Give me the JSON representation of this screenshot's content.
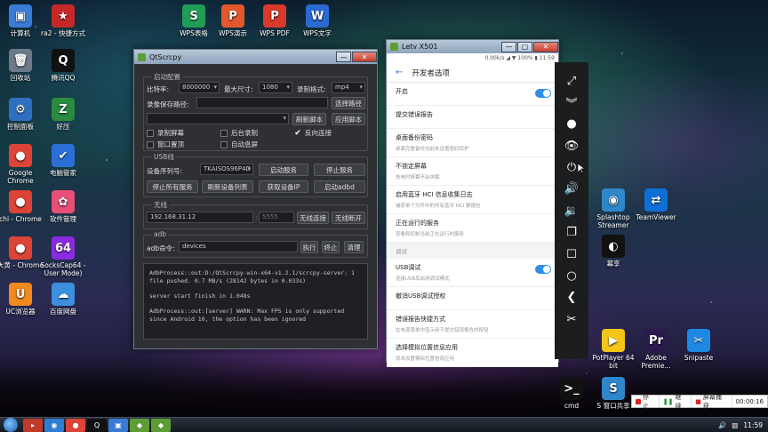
{
  "desktop_icons_left": [
    {
      "label": "计算机",
      "glyph": "▣",
      "color": "#3a7bd5"
    },
    {
      "label": "回收站",
      "glyph": "🗑",
      "color": "#6c7a89"
    },
    {
      "label": "控制面板",
      "glyph": "⚙",
      "color": "#2f6fc0"
    },
    {
      "label": "Google Chrome",
      "glyph": "●",
      "color": "#db4437"
    },
    {
      "label": "chi - Chrome",
      "glyph": "●",
      "color": "#db4437"
    },
    {
      "label": "大黄 - Chrome",
      "glyph": "●",
      "color": "#db4437"
    },
    {
      "label": "UC浏览器",
      "glyph": "U",
      "color": "#f28a1e"
    }
  ],
  "desktop_icons_col2": [
    {
      "label": "ra2 - 快捷方式",
      "glyph": "★",
      "color": "#c62828"
    },
    {
      "label": "腾讯QQ",
      "glyph": "Q",
      "color": "#111111"
    },
    {
      "label": "好压",
      "glyph": "Z",
      "color": "#2a8a3f"
    },
    {
      "label": "电脑管家",
      "glyph": "✔",
      "color": "#2b6fd6"
    },
    {
      "label": "软件管理",
      "glyph": "✿",
      "color": "#e94e77"
    },
    {
      "label": "SocksCap64 - User Mode)",
      "glyph": "64",
      "color": "#8a2be2"
    },
    {
      "label": "百度网盘",
      "glyph": "☁",
      "color": "#3d8fe0"
    }
  ],
  "desktop_icons_top": [
    {
      "label": "WPS表格",
      "glyph": "S",
      "color": "#1f9d55"
    },
    {
      "label": "WPS演示",
      "glyph": "P",
      "color": "#e3572d"
    },
    {
      "label": "WPS PDF",
      "glyph": "P",
      "color": "#d93a2b"
    },
    {
      "label": "WPS文字",
      "glyph": "W",
      "color": "#2a6ad3"
    }
  ],
  "desktop_icons_right": [
    {
      "label": "Splashtop Streamer",
      "glyph": "◉",
      "color": "#2f86c9"
    },
    {
      "label": "TeamViewer",
      "glyph": "⇄",
      "color": "#0e6fd6"
    },
    {
      "label": "幕享",
      "glyph": "◐",
      "color": "#111111"
    },
    {
      "label": "PotPlayer 64 bit",
      "glyph": "▶",
      "color": "#f5c518"
    },
    {
      "label": "Adobe Premie...",
      "glyph": "Pr",
      "color": "#2b1b4d"
    },
    {
      "label": "Snipaste",
      "glyph": "✂",
      "color": "#1e88e5"
    },
    {
      "label": "cmd",
      "glyph": ">_",
      "color": "#111111"
    },
    {
      "label": "S 窗口共享",
      "glyph": "S",
      "color": "#2f86c9"
    }
  ],
  "qtscrcpy": {
    "title": "QtScrcpy",
    "start_config": {
      "group_label": "启动配置",
      "bitrate_label": "比特率:",
      "bitrate_value": "8000000",
      "max_size_label": "最大尺寸:",
      "max_size_value": "1080",
      "record_format_label": "录制格式:",
      "record_format_value": "mp4",
      "record_path_label": "录像保存路径:",
      "record_path_value": "",
      "select_path_button": "选择路径",
      "refresh_script_button": "刷新脚本",
      "apply_script_button": "应用脚本",
      "checkboxes": [
        {
          "label": "录制屏幕",
          "checked": false
        },
        {
          "label": "后台录制",
          "checked": false
        },
        {
          "label": "反向连接",
          "checked": true
        },
        {
          "label": "窗口置顶",
          "checked": false
        },
        {
          "label": "自动息屏",
          "checked": false
        }
      ]
    },
    "usb": {
      "group_label": "USB线",
      "serial_label": "设备序列号:",
      "serial_value": "TKAISOS96P4D",
      "start_service": "启动服务",
      "stop_service": "停止服务",
      "stop_all": "停止所有服务",
      "refresh_devices": "刷新设备列表",
      "get_ip": "获取设备IP",
      "start_adbd": "启动adbd"
    },
    "wireless": {
      "group_label": "无线",
      "ip_value": "192.168.31.12",
      "port_value": "5555",
      "connect": "无线连接",
      "disconnect": "无线断开"
    },
    "adb": {
      "group_label": "adb",
      "command_label": "adb命令:",
      "command_value": "devices",
      "execute": "执行",
      "terminate": "终止",
      "clear": "清理"
    },
    "log": [
      "AdbProcess::out:D:/QtScrcpy-win-x64-v1.2.1/scrcpy-server: 1 file pushed. 0.7 MB/s (28142 bytes in 0.033s)",
      "server start finish in 1.048s",
      "AdbProcess::out:[server] WARN: Max FPS is only supported since Android 10, the option has been ignored"
    ]
  },
  "phone": {
    "title": "Letv X501",
    "status": "0.00k/s ◢ ▼ 100% ▮ 11:59",
    "appbar_title": "开发者选项",
    "rows": [
      {
        "title": "开启",
        "subtitle": "",
        "toggle": true,
        "section": false
      },
      {
        "title": "提交错误报告",
        "subtitle": "",
        "toggle": false,
        "section": false
      },
      {
        "title": "桌面备份密码",
        "subtitle": "桌面完整备份当前未设置密码保护",
        "toggle": false,
        "section": false
      },
      {
        "title": "不锁定屏幕",
        "subtitle": "充电时屏幕不会休眠",
        "toggle": false,
        "section": false
      },
      {
        "title": "启用蓝牙 HCI 信息收集日志",
        "subtitle": "捕获单个文件中的所有蓝牙 HCI 数据包",
        "toggle": false,
        "section": false
      },
      {
        "title": "正在运行的服务",
        "subtitle": "查看和控制当前正在运行的服务",
        "toggle": false,
        "section": false
      },
      {
        "title": "调试",
        "subtitle": "",
        "toggle": false,
        "section": true
      },
      {
        "title": "USB调试",
        "subtitle": "连接USB后启用调试模式",
        "toggle": true,
        "section": false
      },
      {
        "title": "撤消USB调试授权",
        "subtitle": "",
        "toggle": false,
        "section": false
      },
      {
        "title": "错误报告快捷方式",
        "subtitle": "在电源菜单中显示用于提交错误报告的按钮",
        "toggle": false,
        "section": false
      },
      {
        "title": "选择模拟位置信息应用",
        "subtitle": "尚未设置模拟位置信息应用",
        "toggle": false,
        "section": false
      }
    ]
  },
  "side_toolbar": [
    {
      "name": "fullscreen-icon",
      "glyph": "⤢"
    },
    {
      "name": "expand-down-icon",
      "glyph": "︾"
    },
    {
      "name": "screen-off-icon",
      "glyph": "●"
    },
    {
      "name": "touch-visibility-icon",
      "glyph": "👁"
    },
    {
      "name": "power-icon",
      "glyph": "⏻"
    },
    {
      "name": "volume-up-icon",
      "glyph": "🔊"
    },
    {
      "name": "volume-down-icon",
      "glyph": "🔉"
    },
    {
      "name": "app-switch-icon",
      "glyph": "❐"
    },
    {
      "name": "menu-icon",
      "glyph": "☐"
    },
    {
      "name": "home-icon",
      "glyph": "○"
    },
    {
      "name": "back-icon",
      "glyph": "❮"
    },
    {
      "name": "screenshot-icon",
      "glyph": "✂"
    }
  ],
  "recorder": {
    "stop": "停止",
    "continue": "继续",
    "capture": "屏幕捕获",
    "time": "00:00:16"
  },
  "taskbar": {
    "clock": "11:59",
    "apps": [
      {
        "glyph": "▸",
        "color": "#c0392b"
      },
      {
        "glyph": "◉",
        "color": "#2d7dd2"
      },
      {
        "glyph": "●",
        "color": "#db4437"
      },
      {
        "glyph": "Q",
        "color": "#111111"
      },
      {
        "glyph": "▣",
        "color": "#3a7bd5"
      },
      {
        "glyph": "◆",
        "color": "#5c9e35"
      },
      {
        "glyph": "◆",
        "color": "#5c9e35"
      }
    ]
  }
}
